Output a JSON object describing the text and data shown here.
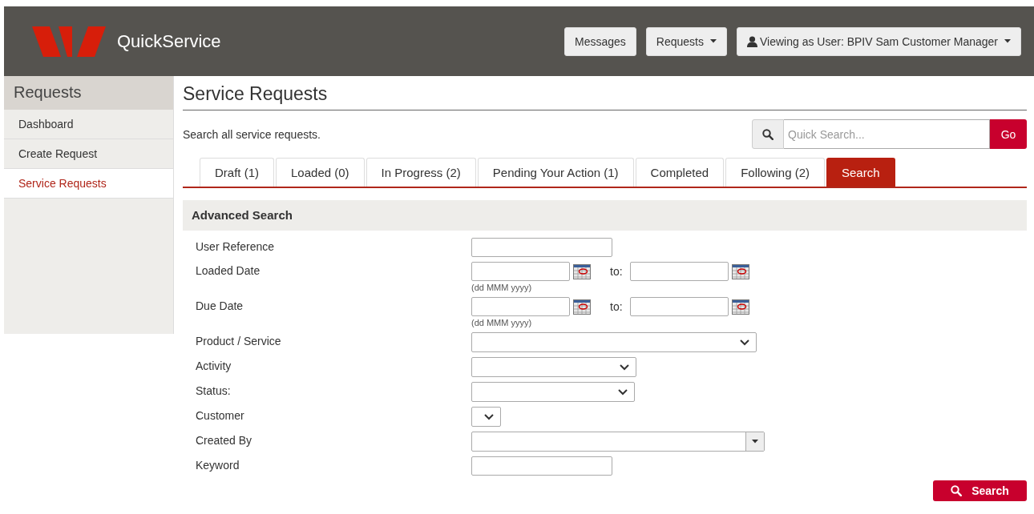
{
  "header": {
    "app_name": "QuickService",
    "buttons": [
      {
        "kind": "plain",
        "label": "Messages"
      },
      {
        "kind": "dropdown",
        "label": "Requests"
      },
      {
        "kind": "user-dropdown",
        "label": "Viewing as User: BPIV Sam Customer Manager"
      }
    ]
  },
  "sidebar": {
    "title": "Requests",
    "items": [
      {
        "label": "Dashboard",
        "selected": false
      },
      {
        "label": "Create Request",
        "selected": false
      },
      {
        "label": "Service Requests",
        "selected": true
      }
    ]
  },
  "main": {
    "title": "Service Requests",
    "description": "Search all service requests.",
    "quick_search": {
      "placeholder": "Quick Search...",
      "button": "Go"
    },
    "tabs": [
      {
        "label": "Draft (1)",
        "selected": false
      },
      {
        "label": "Loaded (0)",
        "selected": false
      },
      {
        "label": "In Progress (2)",
        "selected": false
      },
      {
        "label": "Pending Your Action (1)",
        "selected": false
      },
      {
        "label": "Completed",
        "selected": false
      },
      {
        "label": "Following (2)",
        "selected": false
      },
      {
        "label": "Search",
        "selected": true
      }
    ],
    "advanced_search": {
      "title": "Advanced Search",
      "fields": [
        {
          "kind": "text",
          "label": "User Reference"
        },
        {
          "kind": "daterange",
          "label": "Loaded Date",
          "to_label": "to:",
          "hint": "(dd MMM yyyy)"
        },
        {
          "kind": "daterange",
          "label": "Due Date",
          "to_label": "to:",
          "hint": "(dd MMM yyyy)"
        },
        {
          "kind": "select",
          "label": "Product / Service"
        },
        {
          "kind": "select",
          "label": "Activity"
        },
        {
          "kind": "select",
          "label": "Status:"
        },
        {
          "kind": "select",
          "label": "Customer"
        },
        {
          "kind": "combo",
          "label": "Created By"
        },
        {
          "kind": "text",
          "label": "Keyword"
        }
      ],
      "search_button": "Search"
    }
  }
}
